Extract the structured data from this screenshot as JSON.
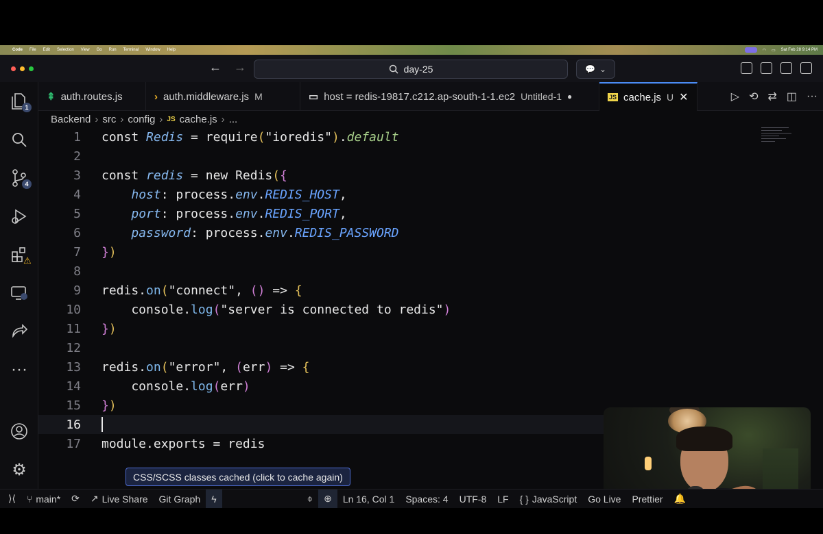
{
  "menubar": {
    "app": "Code",
    "items": [
      "File",
      "Edit",
      "Selection",
      "View",
      "Go",
      "Run",
      "Terminal",
      "Window",
      "Help"
    ],
    "datetime": "Sat Feb 28  9:14 PM"
  },
  "titlebar": {
    "search_text": "day-25"
  },
  "activity": {
    "explorer_badge": "1",
    "scm_badge": "4"
  },
  "tabs": [
    {
      "icon": "⇞",
      "icon_color": "#2fbf71",
      "label": "auth.routes.js",
      "status": ""
    },
    {
      "icon": "›",
      "icon_color": "#f0b429",
      "label": "auth.middleware.js",
      "status": "M"
    },
    {
      "icon": "▭",
      "icon_color": "#cfcfcf",
      "label": "host = redis-19817.c212.ap-south-1-1.ec2",
      "status": "Untitled-1"
    },
    {
      "icon": "JS",
      "icon_color": "#f0d54a",
      "label": "cache.js",
      "status": "U"
    }
  ],
  "breadcrumb": [
    "Backend",
    "src",
    "config",
    "cache.js",
    "..."
  ],
  "code": {
    "current_line": 16
  },
  "tooltip": "CSS/SCSS classes cached (click to cache again)",
  "statusbar": {
    "branch": "main*",
    "live_share": "Live Share",
    "git_graph": "Git Graph",
    "position": "Ln 16, Col 1",
    "spaces": "Spaces: 4",
    "encoding": "UTF-8",
    "eol": "LF",
    "language": "JavaScript",
    "go_live": "Go Live",
    "prettier": "Prettier"
  }
}
